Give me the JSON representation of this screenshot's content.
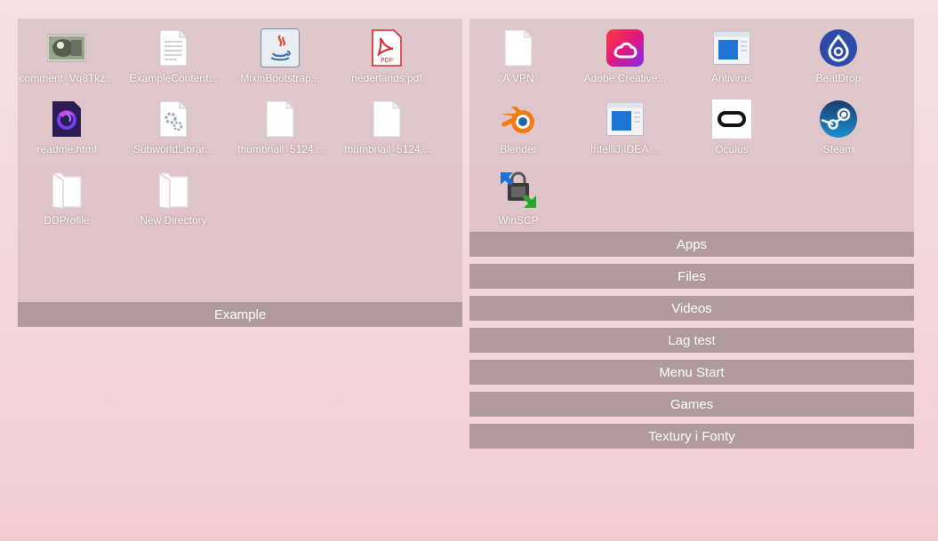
{
  "fence_left": {
    "title": "Example",
    "items": [
      {
        "label": "comment_Vq8Tkz...",
        "icon": "image-thumbnail-icon"
      },
      {
        "label": "ExampleContent...",
        "icon": "document-icon"
      },
      {
        "label": "MixinBootstrap...",
        "icon": "java-icon"
      },
      {
        "label": "nederlands.pdf",
        "icon": "pdf-icon"
      },
      {
        "label": "readme.html",
        "icon": "firefox-icon"
      },
      {
        "label": "SubworldLibrar...",
        "icon": "settings-file-icon"
      },
      {
        "label": "thumbnail_5124...",
        "icon": "blank-file-icon"
      },
      {
        "label": "thumbnail_5124...",
        "icon": "blank-file-icon"
      },
      {
        "label": "DDProfile",
        "icon": "folder-icon"
      },
      {
        "label": "New Directory",
        "icon": "folder-icon"
      }
    ]
  },
  "fence_apps": {
    "title": "Apps",
    "items": [
      {
        "label": "A VPN",
        "icon": "blank-file-icon"
      },
      {
        "label": "Adobe Creative...",
        "icon": "adobe-creative-cloud-icon"
      },
      {
        "label": "Antivirus",
        "icon": "window-app-icon"
      },
      {
        "label": "BeatDrop",
        "icon": "beatdrop-icon"
      },
      {
        "label": "Blender",
        "icon": "blender-icon"
      },
      {
        "label": "IntelliJ IDEA ...",
        "icon": "window-app-icon"
      },
      {
        "label": "Oculus",
        "icon": "oculus-icon"
      },
      {
        "label": "Steam",
        "icon": "steam-icon"
      },
      {
        "label": "WinSCP",
        "icon": "winscp-icon"
      }
    ]
  },
  "collapsed_fences": [
    "Files",
    "Videos",
    "Lag test",
    "Menu Start",
    "Games",
    "Textury i Fonty"
  ],
  "colors": {
    "fence_bg": "#dcc8cb",
    "title_bar": "#b09a9d",
    "label_text": "#ffffff",
    "desktop_bg": "#f3dde1"
  }
}
